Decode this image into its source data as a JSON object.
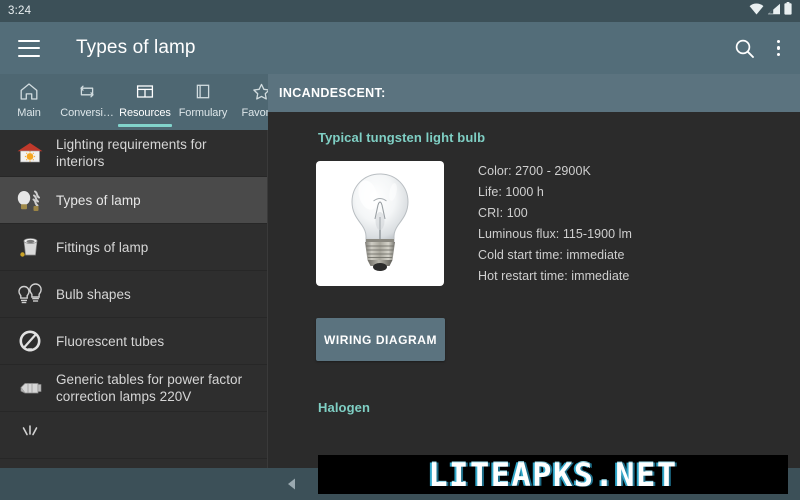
{
  "statusbar": {
    "clock": "3:24",
    "icons": [
      "wifi-icon",
      "signal-icon",
      "battery-icon"
    ]
  },
  "appbar": {
    "menu_icon": "hamburger-menu-icon",
    "title": "Types of lamp",
    "search_icon": "search-icon",
    "overflow_icon": "overflow-menu-icon"
  },
  "tabs": {
    "active_index": 2,
    "items": [
      {
        "label": "Main",
        "icon": "home-icon"
      },
      {
        "label": "Conversi…",
        "icon": "convert-icon"
      },
      {
        "label": "Resources",
        "icon": "table-columns-icon"
      },
      {
        "label": "Formulary",
        "icon": "book-icon"
      },
      {
        "label": "Favorite",
        "icon": "star-icon"
      }
    ]
  },
  "sidebar": {
    "selected_index": 1,
    "items": [
      {
        "label": "Lighting requirements for interiors",
        "icon": "house-with-sun-icon"
      },
      {
        "label": "Types of lamp",
        "icon": "two-lamps-icon"
      },
      {
        "label": "Fittings of lamp",
        "icon": "lamp-socket-icon"
      },
      {
        "label": "Bulb shapes",
        "icon": "two-bulb-outlines-icon"
      },
      {
        "label": "Fluorescent tubes",
        "icon": "circular-tube-icon"
      },
      {
        "label": "Generic tables for power factor correction lamps 220V",
        "icon": "capacitor-icon"
      },
      {
        "label": "",
        "icon": "light-burst-icon"
      }
    ]
  },
  "content": {
    "header": "INCANDESCENT:",
    "section_title": "Typical tungsten light bulb",
    "bulb_image_alt": "incandescent-light-bulb",
    "specs": [
      "Color: 2700 - 2900K",
      "Life: 1000 h",
      "CRI: 100",
      "Luminous flux: 115-1900 lm",
      "Cold start time: immediate",
      "Hot restart time: immediate"
    ],
    "wiring_button": "WIRING DIAGRAM",
    "next_section_title": "Halogen"
  },
  "navbar": {
    "back_icon": "back-triangle-icon"
  },
  "watermark": {
    "text": "LITEAPKS.NET"
  },
  "colors": {
    "statusbar": "#3c5058",
    "appbar": "#536d79",
    "tabstrip": "#4e6772",
    "tab_indicator": "#81d4cc",
    "content_header": "#5b737f",
    "sidebar_bg": "#2e2e2e",
    "sidebar_selected": "#4a4a4a",
    "content_bg": "#2b2b2b",
    "accent_text": "#7fcfc4",
    "button_bg": "#5b737f"
  }
}
